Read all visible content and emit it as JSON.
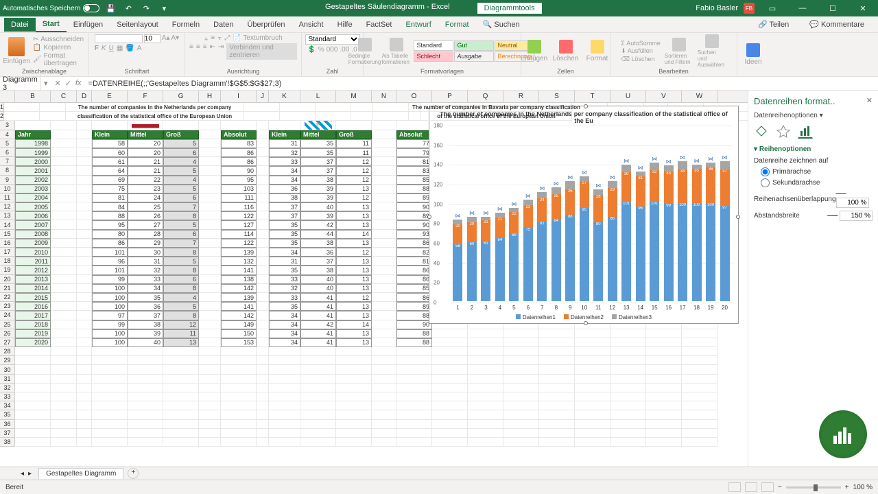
{
  "title": {
    "autosave": "Automatisches Speichern",
    "filename": "Gestapeltes Säulendiagramm - Excel",
    "chart_tools": "Diagrammtools",
    "user": "Fabio Basler"
  },
  "menu": {
    "file": "Datei",
    "tabs": [
      "Start",
      "Einfügen",
      "Seitenlayout",
      "Formeln",
      "Daten",
      "Überprüfen",
      "Ansicht",
      "Hilfe",
      "FactSet"
    ],
    "context": [
      "Entwurf",
      "Format"
    ],
    "search_ico": "🔍",
    "search": "Suchen",
    "share": "Teilen",
    "comments": "Kommentare"
  },
  "ribbon": {
    "paste": "Einfügen",
    "cut": "Ausschneiden",
    "copy": "Kopieren",
    "format_painter": "Format übertragen",
    "group_clip": "Zwischenablage",
    "group_font": "Schriftart",
    "group_align": "Ausrichtung",
    "group_num": "Zahl",
    "wrap": "Textumbruch",
    "merge": "Verbinden und zentrieren",
    "num_std": "Standard",
    "cond": "Bedingte Formatierung",
    "astable": "Als Tabelle formatieren",
    "group_styles": "Formatvorlagen",
    "styles": {
      "standard": "Standard",
      "gut": "Gut",
      "neutral": "Neutral",
      "schlecht": "Schlecht",
      "ausgabe": "Ausgabe",
      "berechnung": "Berechnung"
    },
    "ins": "Einfügen",
    "del": "Löschen",
    "fmt": "Format",
    "group_cells": "Zellen",
    "sum": "AutoSumme",
    "fill": "Ausfüllen",
    "clear": "Löschen",
    "sort": "Sortieren und Filtern",
    "find": "Suchen und Auswählen",
    "group_edit": "Bearbeiten",
    "ideas": "Ideen"
  },
  "namebox": "Diagramm 3",
  "formula": "=DATENREIHE(;;'Gestapeltes Diagramm'!$G$5:$G$27;3)",
  "cols": [
    "B",
    "C",
    "D",
    "E",
    "F",
    "G",
    "H",
    "I",
    "J",
    "K",
    "L",
    "M",
    "N",
    "O",
    "P",
    "Q",
    "R",
    "S",
    "T",
    "U",
    "V",
    "W"
  ],
  "rows_n": 38,
  "tbl1": {
    "title1": "The number of companies in the Netherlands per company",
    "title2": "classification of the statistical office of the European Union",
    "headers": [
      "Jahr",
      "Klein",
      "Mittel",
      "Groß",
      "Absolut"
    ]
  },
  "tbl2": {
    "title1": "The number of companies in Bavaria per company classification",
    "title2": "of the statistical office of the European Union",
    "headers": [
      "Klein",
      "Mittel",
      "Groß",
      "Absolut"
    ]
  },
  "data1": [
    [
      1998,
      58,
      20,
      5,
      83
    ],
    [
      1999,
      60,
      20,
      6,
      86
    ],
    [
      2000,
      61,
      21,
      4,
      86
    ],
    [
      2001,
      64,
      21,
      5,
      90
    ],
    [
      2002,
      69,
      22,
      4,
      95
    ],
    [
      2003,
      75,
      23,
      5,
      103
    ],
    [
      2004,
      81,
      24,
      6,
      111
    ],
    [
      2005,
      84,
      25,
      7,
      116
    ],
    [
      2006,
      88,
      26,
      8,
      122
    ],
    [
      2007,
      95,
      27,
      5,
      127
    ],
    [
      2008,
      80,
      28,
      6,
      114
    ],
    [
      2009,
      86,
      29,
      7,
      122
    ],
    [
      2010,
      101,
      30,
      8,
      139
    ],
    [
      2011,
      96,
      31,
      5,
      132
    ],
    [
      2012,
      101,
      32,
      8,
      141
    ],
    [
      2013,
      99,
      33,
      6,
      138
    ],
    [
      2014,
      100,
      34,
      8,
      142
    ],
    [
      2015,
      100,
      35,
      4,
      139
    ],
    [
      2016,
      100,
      36,
      5,
      141
    ],
    [
      2017,
      97,
      37,
      8,
      142
    ],
    [
      2018,
      99,
      38,
      12,
      149
    ],
    [
      2019,
      100,
      39,
      11,
      150
    ],
    [
      2020,
      100,
      40,
      13,
      153
    ]
  ],
  "data2": [
    [
      31,
      35,
      11,
      77
    ],
    [
      32,
      35,
      11,
      79
    ],
    [
      33,
      37,
      12,
      81
    ],
    [
      34,
      37,
      12,
      83
    ],
    [
      34,
      38,
      12,
      85
    ],
    [
      36,
      39,
      13,
      88
    ],
    [
      38,
      39,
      12,
      89
    ],
    [
      37,
      40,
      13,
      90
    ],
    [
      37,
      39,
      13,
      89
    ],
    [
      35,
      42,
      13,
      90
    ],
    [
      35,
      44,
      14,
      93
    ],
    [
      35,
      38,
      13,
      86
    ],
    [
      34,
      36,
      12,
      82
    ],
    [
      31,
      37,
      13,
      81
    ],
    [
      35,
      38,
      13,
      86
    ],
    [
      33,
      40,
      13,
      86
    ],
    [
      32,
      40,
      13,
      85
    ],
    [
      33,
      41,
      12,
      86
    ],
    [
      35,
      41,
      13,
      89
    ],
    [
      34,
      41,
      13,
      88
    ],
    [
      34,
      42,
      14,
      90
    ],
    [
      34,
      41,
      13,
      88
    ],
    [
      34,
      41,
      13,
      88
    ]
  ],
  "chart_data": {
    "type": "stacked-bar",
    "title": "The number of companies in the Netherlands per company classification of the statistical office of the Eu",
    "x": [
      1,
      2,
      3,
      4,
      5,
      6,
      7,
      8,
      9,
      10,
      11,
      12,
      13,
      14,
      15,
      16,
      17,
      18,
      19,
      20
    ],
    "series": [
      {
        "name": "Datenreihen1",
        "values": [
          58,
          60,
          61,
          64,
          69,
          75,
          81,
          84,
          88,
          95,
          80,
          86,
          101,
          96,
          101,
          99,
          100,
          100,
          100,
          97
        ]
      },
      {
        "name": "Datenreihen2",
        "values": [
          20,
          20,
          21,
          21,
          22,
          23,
          24,
          25,
          26,
          27,
          28,
          29,
          30,
          31,
          32,
          33,
          34,
          35,
          36,
          37
        ]
      },
      {
        "name": "Datenreihen3",
        "values": [
          5,
          6,
          4,
          5,
          4,
          5,
          6,
          7,
          8,
          5,
          6,
          7,
          8,
          5,
          8,
          6,
          8,
          4,
          5,
          8
        ]
      }
    ],
    "labels_on_blue": [
      58,
      60,
      61,
      64,
      69,
      75,
      81,
      84,
      88,
      95,
      80,
      86,
      101,
      96,
      101,
      99,
      100,
      100,
      100,
      97
    ],
    "labels_on_orange": [
      20,
      20,
      21,
      21,
      22,
      23,
      24,
      25,
      26,
      27,
      28,
      29,
      30,
      31,
      32,
      33,
      34,
      35,
      36,
      37
    ],
    "y_ticks": [
      0,
      20,
      40,
      60,
      80,
      100,
      120,
      140,
      160,
      180
    ],
    "ylim": [
      0,
      180
    ]
  },
  "pane": {
    "title": "Datenreihen format..",
    "subtitle": "Datenreihenoptionen",
    "section": "Reihenoptionen",
    "draw_on": "Datenreihe zeichnen auf",
    "primary": "Primärachse",
    "secondary": "Sekundärachse",
    "overlap": "Reihenachsenüberlappung",
    "overlap_v": "100 %",
    "gap": "Abstandsbreite",
    "gap_v": "150 %"
  },
  "sheet": "Gestapeltes Diagramm",
  "status": {
    "ready": "Bereit",
    "zoom": "100 %"
  }
}
